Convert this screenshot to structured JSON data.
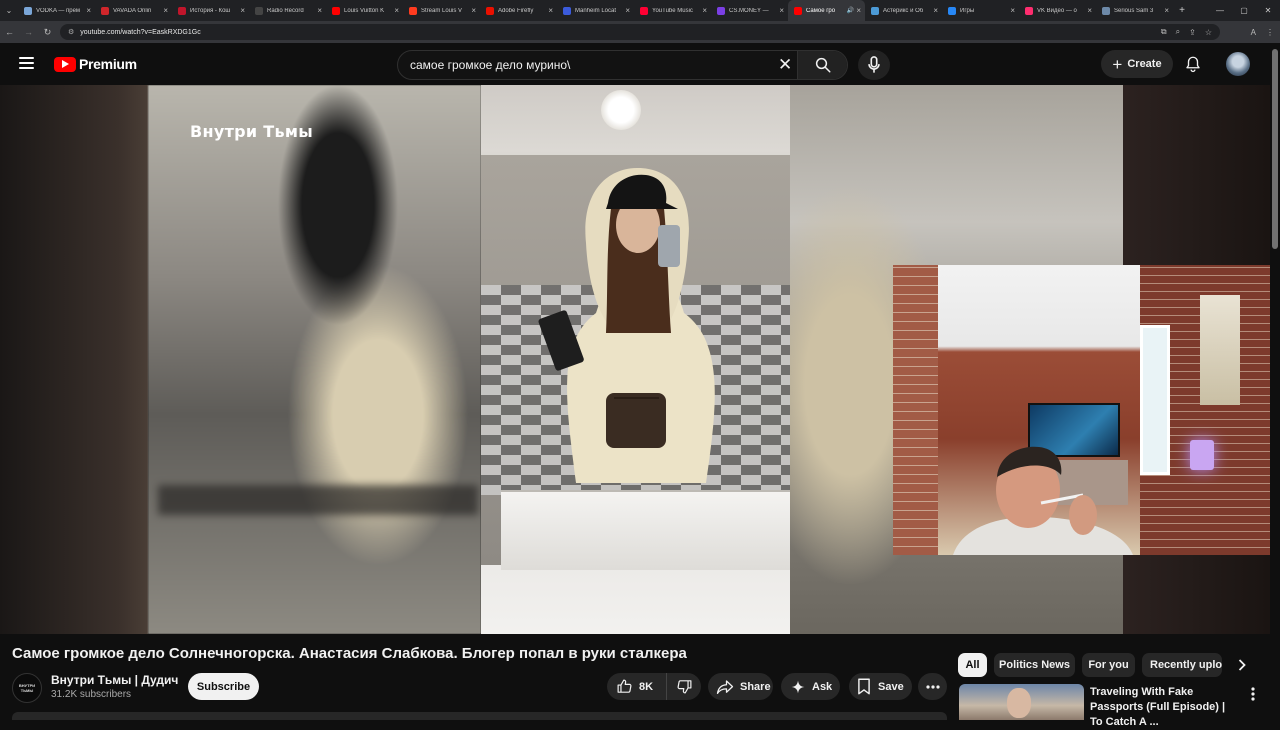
{
  "browser": {
    "tabs": [
      {
        "title": "VODKA — прем",
        "color": "#7aa6d8",
        "active": false
      },
      {
        "title": "VAVADA Onlin",
        "color": "#d0262b",
        "active": false
      },
      {
        "title": "История - Кош",
        "color": "#c0152b",
        "active": false
      },
      {
        "title": "Radio Record",
        "color": "#444444",
        "active": false
      },
      {
        "title": "Louis Vuitton K",
        "color": "#ff0000",
        "active": false
      },
      {
        "title": "Stream Louis V",
        "color": "#ff3b1f",
        "active": false
      },
      {
        "title": "Adobe Firefly",
        "color": "#eb1000",
        "active": false
      },
      {
        "title": "Manheim Locat",
        "color": "#3b5bdb",
        "active": false
      },
      {
        "title": "YouTube Music",
        "color": "#ff0033",
        "active": false
      },
      {
        "title": "CS.MONEY —",
        "color": "#7b3fe4",
        "active": false
      },
      {
        "title": "Самое гро",
        "color": "#ff0000",
        "active": true
      },
      {
        "title": "Астерикс и Об",
        "color": "#4c9ad6",
        "active": false
      },
      {
        "title": "Игры",
        "color": "#2787f5",
        "active": false
      },
      {
        "title": "VK Видео — о",
        "color": "#ff2d6f",
        "active": false
      },
      {
        "title": "Serious Sam 3",
        "color": "#6d89a8",
        "active": false
      }
    ],
    "url": "youtube.com/watch?v=EaskRXDG1Gc"
  },
  "header": {
    "logo_text": "Premium",
    "search_value": "самое громкое дело мурино\\",
    "create_label": "Create"
  },
  "video": {
    "overlay_title": "Внутри Тьмы",
    "title": "Самое громкое дело Солнечногорска. Анастасия Слабкова. Блогер попал в руки сталкера"
  },
  "channel": {
    "avatar_text": "ВНУТРИ ТЬМЫ",
    "name": "Внутри Тьмы | Дудич",
    "subscribers": "31.2K subscribers",
    "subscribe_label": "Subscribe"
  },
  "actions": {
    "likes": "8K",
    "share": "Share",
    "ask": "Ask",
    "save": "Save"
  },
  "chips": [
    {
      "label": "All",
      "active": true
    },
    {
      "label": "Politics News",
      "active": false
    },
    {
      "label": "For you",
      "active": false
    },
    {
      "label": "Recently uploa",
      "active": false
    }
  ],
  "recommendation": {
    "title": "Traveling With Fake Passports (Full Episode) | To Catch A ..."
  },
  "colors": {
    "accent": "#ff0000",
    "background": "#0f0f0f",
    "surface": "#272727"
  }
}
